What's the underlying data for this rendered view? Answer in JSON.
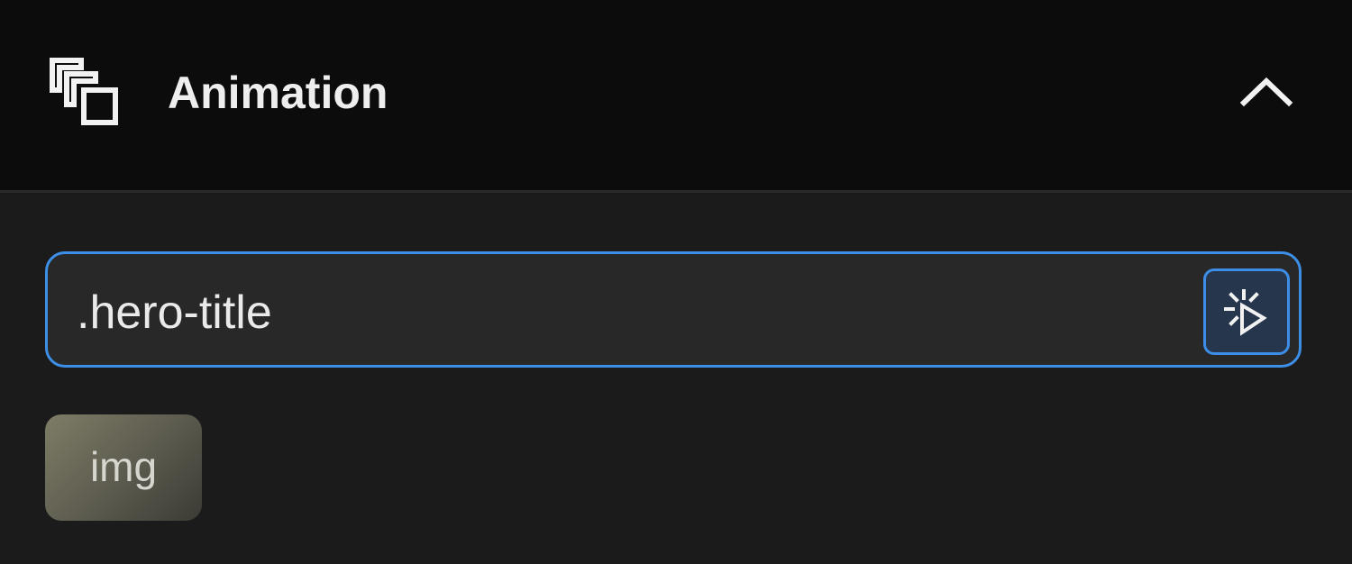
{
  "header": {
    "icon": "layers-icon",
    "title": "Animation",
    "collapse_icon": "chevron-up-icon"
  },
  "selector": {
    "value": ".hero-title",
    "picker_icon": "element-picker-icon",
    "accent_color": "#3d8ee6"
  },
  "tags": [
    {
      "label": "img"
    }
  ]
}
